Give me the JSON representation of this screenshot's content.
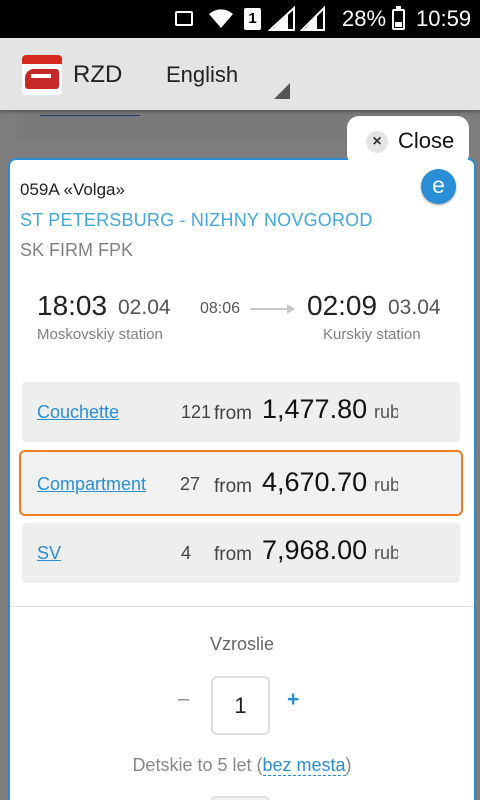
{
  "status_bar": {
    "battery": "28%",
    "time": "10:59",
    "sim_slot": "1"
  },
  "header": {
    "app_title": "RZD",
    "language": "English"
  },
  "modal": {
    "close_label": "Close",
    "train_number": "059A «Volga»",
    "route": "ST PETERSBURG - NIZHNY NOVGOROD",
    "carrier": "SK FIRM  FPK",
    "departure": {
      "time": "18:03",
      "date": "02.04",
      "station": "Moskovskiy station"
    },
    "duration": "08:06",
    "arrival": {
      "time": "02:09",
      "date": "03.04",
      "station": "Kurskiy station"
    },
    "classes": [
      {
        "name": "Couchette",
        "seats": "121",
        "from": "from",
        "price": "1,477.80",
        "currency": "rub"
      },
      {
        "name": "Compartment",
        "seats": "27",
        "from": "from",
        "price": "4,670.70",
        "currency": "rub"
      },
      {
        "name": "SV",
        "seats": "4",
        "from": "from",
        "price": "7,968.00",
        "currency": "rub"
      }
    ],
    "adults_label": "Vzroslie",
    "adults_minus": "–",
    "adults_count": "1",
    "adults_plus": "+",
    "children_label": "Detskie to 5 let (",
    "children_link": "bez mesta",
    "children_close": ")"
  },
  "colors": {
    "accent_blue": "#2a8ed6",
    "route_blue": "#43a6dc",
    "selected_orange": "#ef7d22",
    "modal_border": "#2b8dcf"
  }
}
